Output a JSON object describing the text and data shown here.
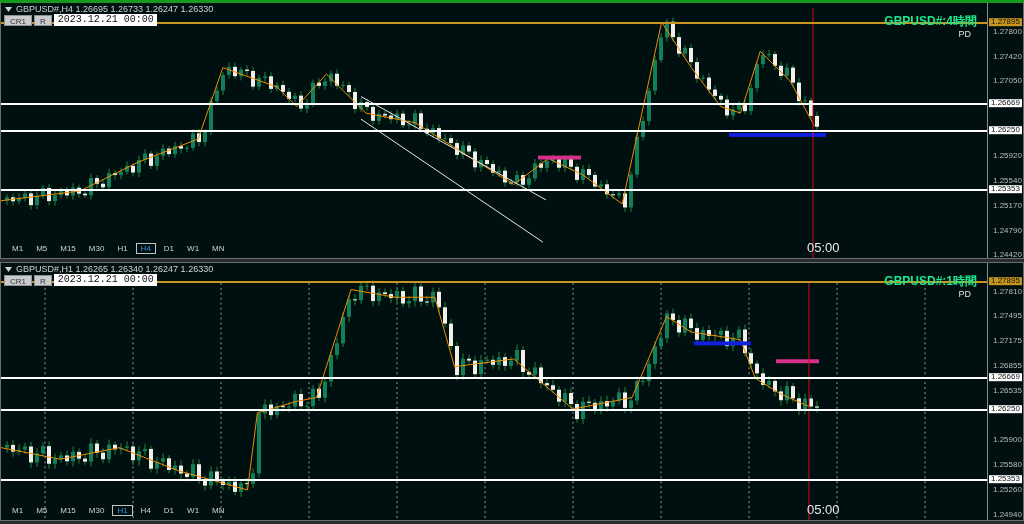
{
  "panels": [
    {
      "header": "GBPUSD#,H4  1.26695 1.26733 1.26247 1.26330",
      "buttons": [
        "CR1",
        "R"
      ],
      "date": "2023.12.21 00:00",
      "indicator_label": "GBPUSD#:4時間",
      "indicator_sub": "PD",
      "time_label": "05:00",
      "timeframes": [
        {
          "label": "M1",
          "selected": false
        },
        {
          "label": "M5",
          "selected": false
        },
        {
          "label": "M15",
          "selected": false
        },
        {
          "label": "M30",
          "selected": false
        },
        {
          "label": "H1",
          "selected": false
        },
        {
          "label": "H4",
          "selected": true
        },
        {
          "label": "D1",
          "selected": false
        },
        {
          "label": "W1",
          "selected": false
        },
        {
          "label": "MN",
          "selected": false
        }
      ],
      "price_ticks": [
        "1.27800",
        "1.27420",
        "1.27050",
        "1.25920",
        "1.25540",
        "1.25170",
        "1.24790",
        "1.24420"
      ],
      "levels": [
        {
          "price": "1.27895",
          "color": "#c8961e"
        },
        {
          "price": "1.26669",
          "color": "#ffffff"
        },
        {
          "price": "1.26250",
          "color": "#ffffff"
        },
        {
          "price": "1.25353",
          "color": "#ffffff"
        }
      ]
    },
    {
      "header": "GBPUSD#,H1  1.26265 1.26340 1.26247 1.26330",
      "buttons": [
        "CR1",
        "R"
      ],
      "date": "2023.12.21 00:00",
      "indicator_label": "GBPUSD#:1時間",
      "indicator_sub": "PD",
      "time_label": "05:00",
      "timeframes": [
        {
          "label": "M1",
          "selected": false
        },
        {
          "label": "M5",
          "selected": false
        },
        {
          "label": "M15",
          "selected": false
        },
        {
          "label": "M30",
          "selected": false
        },
        {
          "label": "H1",
          "selected": true
        },
        {
          "label": "H4",
          "selected": false
        },
        {
          "label": "D1",
          "selected": false
        },
        {
          "label": "W1",
          "selected": false
        },
        {
          "label": "MN",
          "selected": false
        }
      ],
      "price_ticks": [
        "1.27810",
        "1.27495",
        "1.27175",
        "1.26855",
        "1.26535",
        "1.25900",
        "1.25580",
        "1.25260",
        "1.24940"
      ],
      "levels": [
        {
          "price": "1.27895",
          "color": "#c8961e"
        },
        {
          "price": "1.26669",
          "color": "#ffffff"
        },
        {
          "price": "1.26250",
          "color": "#ffffff"
        },
        {
          "price": "1.25353",
          "color": "#ffffff"
        }
      ]
    }
  ]
}
